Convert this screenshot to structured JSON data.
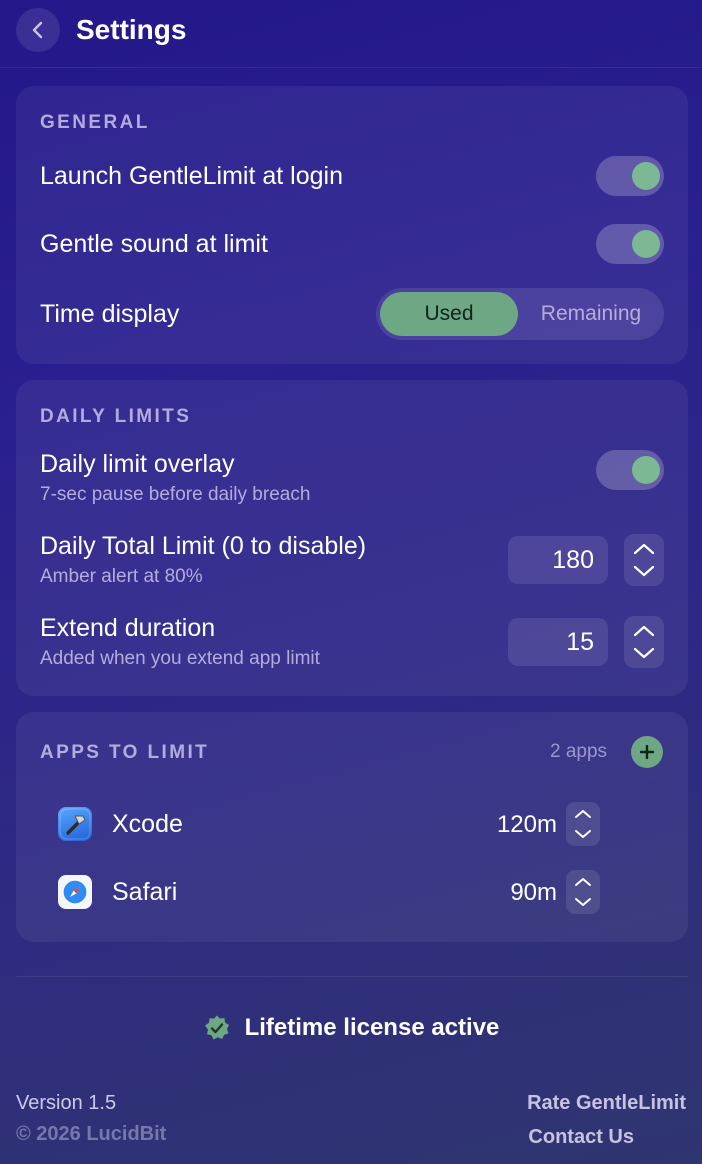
{
  "header": {
    "title": "Settings"
  },
  "general": {
    "title": "GENERAL",
    "launch_label": "Launch GentleLimit at login",
    "sound_label": "Gentle sound at limit",
    "time_display_label": "Time display",
    "time_display_options": [
      "Used",
      "Remaining"
    ],
    "time_display_selected": "Used"
  },
  "daily": {
    "title": "DAILY LIMITS",
    "overlay_label": "Daily limit overlay",
    "overlay_sub": "7-sec pause before daily breach",
    "total_label": "Daily Total Limit (0 to disable)",
    "total_sub": "Amber alert at 80%",
    "total_value": "180",
    "extend_label": "Extend duration",
    "extend_sub": "Added when you extend app limit",
    "extend_value": "15"
  },
  "apps": {
    "title": "APPS TO LIMIT",
    "count": "2 apps",
    "items": [
      {
        "name": "Xcode",
        "limit": "120m",
        "icon": "hammer-icon"
      },
      {
        "name": "Safari",
        "limit": "90m",
        "icon": "compass-icon"
      }
    ]
  },
  "license": {
    "text": "Lifetime license active"
  },
  "footer": {
    "version": "Version 1.5",
    "copyright": "© 2026 LucidBit",
    "rate": "Rate GentleLimit",
    "contact": "Contact Us"
  },
  "colors": {
    "accent": "#6ea784",
    "knob": "#7cb893"
  }
}
